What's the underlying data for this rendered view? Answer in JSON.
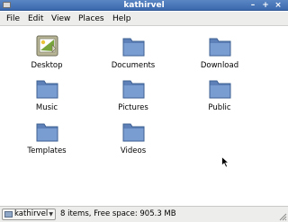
{
  "window": {
    "title": "kathirvel"
  },
  "window_buttons": {
    "minimize": "–",
    "maximize": "+",
    "close": "×"
  },
  "menu": [
    "File",
    "Edit",
    "View",
    "Places",
    "Help"
  ],
  "icons": [
    {
      "label": "Desktop",
      "icon": "desktop-icon"
    },
    {
      "label": "Documents",
      "icon": "folder-icon"
    },
    {
      "label": "Download",
      "icon": "folder-icon"
    },
    {
      "label": "Music",
      "icon": "folder-icon"
    },
    {
      "label": "Pictures",
      "icon": "folder-icon"
    },
    {
      "label": "Public",
      "icon": "folder-icon"
    },
    {
      "label": "Templates",
      "icon": "folder-icon"
    },
    {
      "label": "Videos",
      "icon": "folder-icon"
    }
  ],
  "statusbar": {
    "location": "kathirvel",
    "status": "8 items, Free space: 905.3 MB"
  },
  "colors": {
    "titlebar": "#3b69ad",
    "folder": "#6b8fc4",
    "menubar": "#ededeb"
  }
}
